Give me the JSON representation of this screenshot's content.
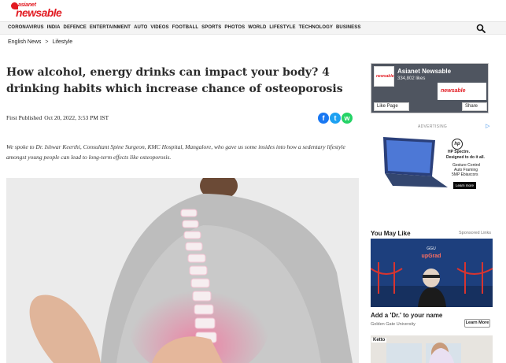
{
  "brand": {
    "small": "asianet",
    "big": "newsable"
  },
  "nav": {
    "items": [
      "CORONAVIRUS",
      "INDIA",
      "DEFENCE",
      "ENTERTAINMENT",
      "AUTO",
      "VIDEOS",
      "FOOTBALL",
      "SPORTS",
      "PHOTOS",
      "WORLD",
      "LIFESTYLE",
      "TECHNOLOGY",
      "BUSINESS"
    ],
    "search_icon": "search-icon"
  },
  "breadcrumb": {
    "home": "English News",
    "separator": ">",
    "section": "Lifestyle"
  },
  "article": {
    "headline": "How alcohol, energy drinks can impact your body? 4 drinking habits which increase chance of osteoporosis",
    "published_label": "First Published",
    "published_date": "Oct 20, 2022, 3:53 PM IST",
    "summary": "We spoke to Dr. Ishwar Keerthi, Consultant Spine Surgeon, KMC Hospital, Mangalore, who gave us some insides into how a sedentary lifestyle amongst young people can lead to long-term effects like osteoporosis."
  },
  "share": [
    {
      "icon": "facebook-icon",
      "glyph": "f",
      "color": "#1877f2"
    },
    {
      "icon": "twitter-icon",
      "glyph": "t",
      "color": "#1da1f2"
    },
    {
      "icon": "whatsapp-icon",
      "glyph": "w",
      "color": "#25d366"
    }
  ],
  "facebook_widget": {
    "name": "Asianet Newsable",
    "likes": "334,802 likes",
    "like_button": "Like Page",
    "share_button": "Share",
    "thumb_text": "newsable",
    "banner_text": "newsable"
  },
  "ad": {
    "label": "ADVERTISING",
    "lines": [
      "HP Spectre.",
      "Designed to do it all.",
      "Gesture Control",
      "Auto Framing",
      "5MP Ebiaxcors"
    ],
    "button": "Learn more",
    "hp_text": "hp"
  },
  "you_may_like": {
    "title": "You May Like",
    "sponsored": "Sponsored Links",
    "items": [
      {
        "title": "Add a 'Dr.' to your name",
        "source": "Golden Gate University",
        "button": "Learn More",
        "img_text": "upGrad"
      },
      {
        "label": "Ketto"
      }
    ]
  },
  "colors": {
    "brand_red": "#e21b22",
    "nav_bg": "#f4f4f4",
    "fb_widget_bg": "#4f5560",
    "promo_bg": "#1b3a72"
  }
}
